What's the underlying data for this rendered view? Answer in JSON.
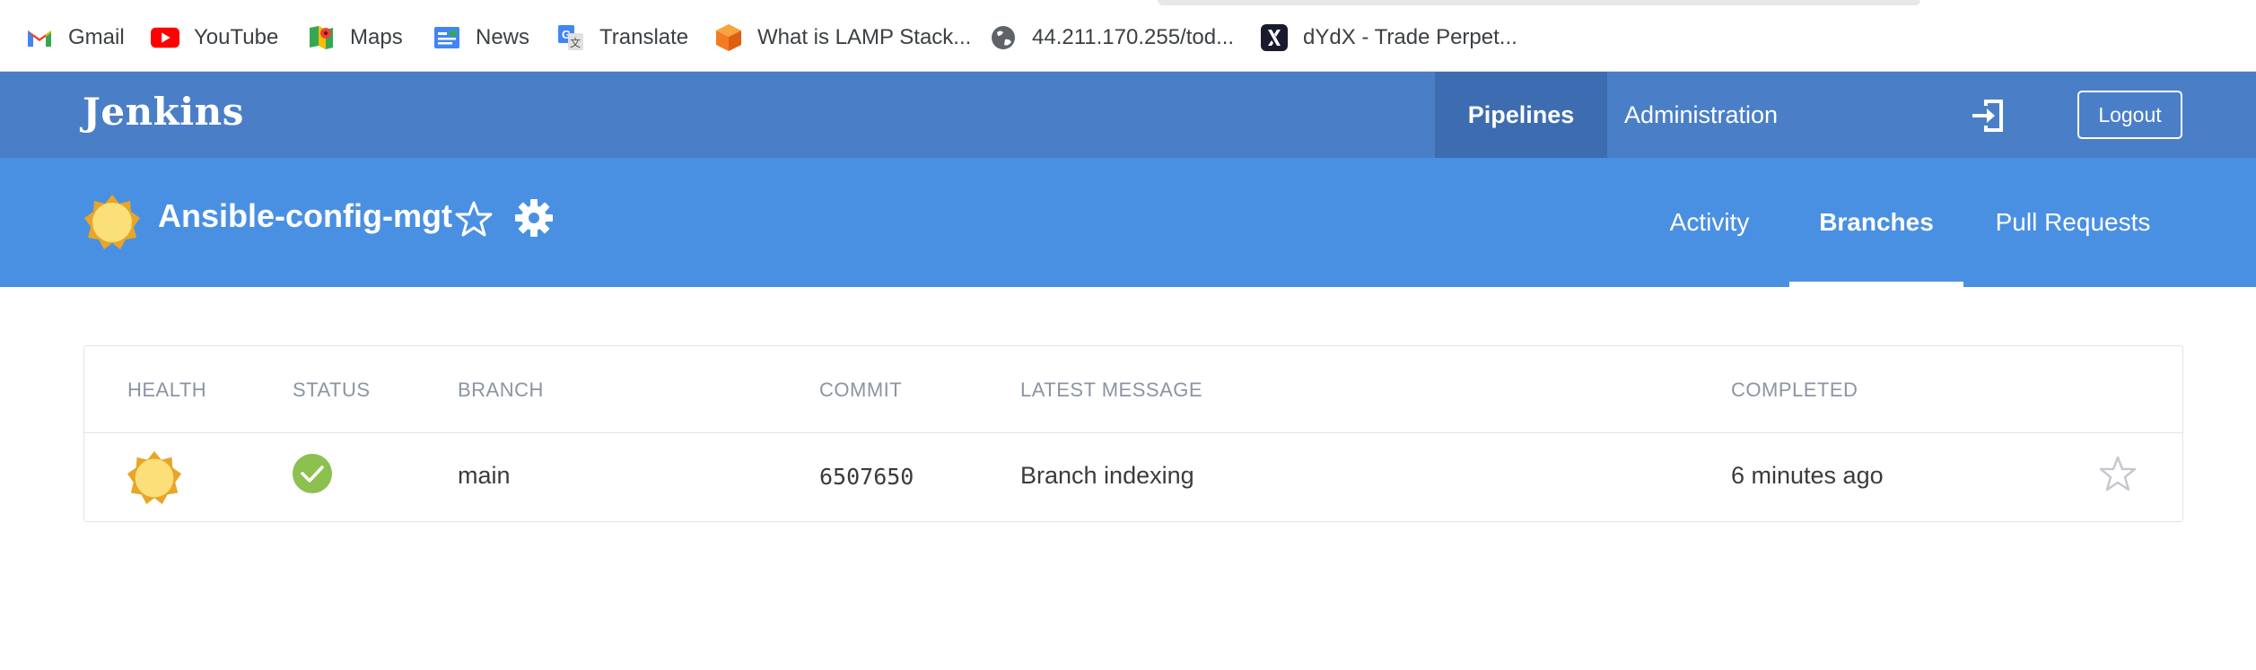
{
  "bookmarks": [
    {
      "label": "Gmail",
      "icon": "gmail-icon"
    },
    {
      "label": "YouTube",
      "icon": "youtube-icon"
    },
    {
      "label": "Maps",
      "icon": "maps-icon"
    },
    {
      "label": "News",
      "icon": "news-icon"
    },
    {
      "label": "Translate",
      "icon": "translate-icon"
    },
    {
      "label": "What is LAMP Stack...",
      "icon": "lamp-cube-icon"
    },
    {
      "label": "44.211.170.255/tod...",
      "icon": "globe-icon"
    },
    {
      "label": "dYdX - Trade Perpet...",
      "icon": "dydx-icon"
    }
  ],
  "header": {
    "brand": "Jenkins",
    "nav": {
      "pipelines": "Pipelines",
      "administration": "Administration"
    },
    "logout": "Logout"
  },
  "pipeline": {
    "name": "Ansible-config-mgt",
    "tabs": {
      "activity": "Activity",
      "branches": "Branches",
      "pull_requests": "Pull Requests"
    }
  },
  "table": {
    "columns": {
      "health": "HEALTH",
      "status": "STATUS",
      "branch": "BRANCH",
      "commit": "COMMIT",
      "message": "LATEST MESSAGE",
      "completed": "COMPLETED"
    },
    "rows": [
      {
        "health": "sunny",
        "status": "success",
        "branch": "main",
        "commit": "6507650",
        "message": "Branch indexing",
        "completed": "6 minutes ago"
      }
    ]
  },
  "colors": {
    "header_dark": "#4a7fc7",
    "header_active": "#3d6cb0",
    "subheader": "#4a90e2",
    "success": "#8cc04f",
    "sun": "#fbe07a"
  }
}
